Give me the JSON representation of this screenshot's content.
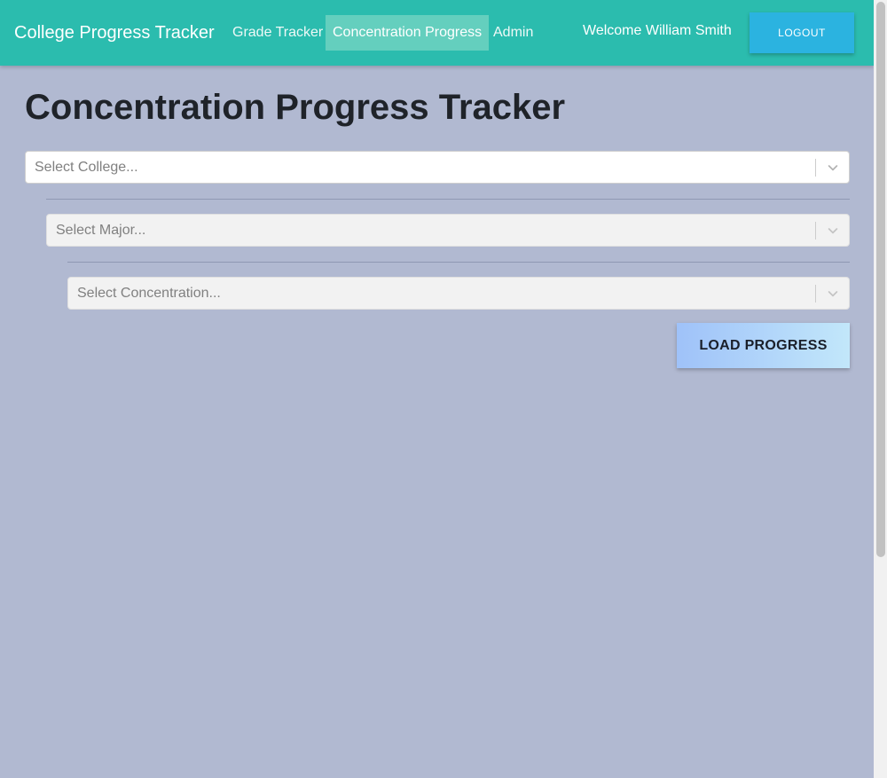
{
  "header": {
    "brand": "College Progress Tracker",
    "nav": [
      {
        "label": "Grade Tracker",
        "active": false
      },
      {
        "label": "Concentration Progress",
        "active": true
      },
      {
        "label": "Admin",
        "active": false
      }
    ],
    "welcome": "Welcome William Smith",
    "logout_label": "LOGOUT"
  },
  "main": {
    "title": "Concentration Progress Tracker",
    "college_select": {
      "placeholder": "Select College...",
      "enabled": true
    },
    "major_select": {
      "placeholder": "Select Major...",
      "enabled": false
    },
    "concentration_select": {
      "placeholder": "Select Concentration...",
      "enabled": false
    },
    "load_button_label": "LOAD PROGRESS"
  },
  "icons": {
    "dropdown": "chevron-down-icon"
  },
  "colors": {
    "header_bg": "#2bbcae",
    "active_nav_bg": "#64cfbe",
    "logout_bg": "#2bb3e0",
    "page_bg": "#b1b9d1",
    "load_button_gradient_start": "#9fc2f9",
    "load_button_gradient_end": "#c2e7fa"
  }
}
